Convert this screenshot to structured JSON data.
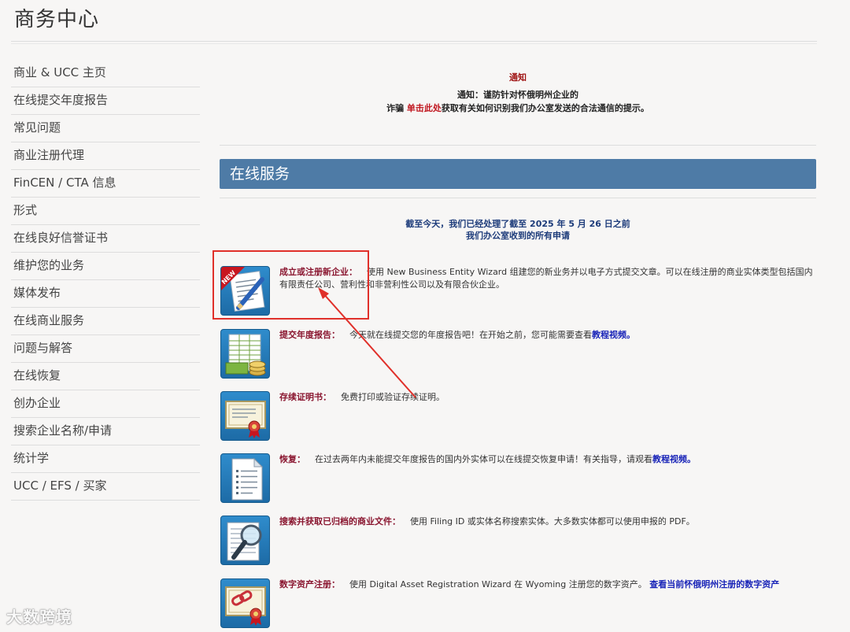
{
  "header": {
    "title": "商务中心"
  },
  "sidebar": {
    "items": [
      "商业 & UCC 主页",
      "在线提交年度报告",
      "常见问题",
      "商业注册代理",
      "FinCEN / CTA 信息",
      "形式",
      "在线良好信誉证书",
      "维护您的业务",
      "媒体发布",
      "在线商业服务",
      "问题与解答",
      "在线恢复",
      "创办企业",
      "搜索企业名称/申请",
      "统计学",
      "UCC / EFS / 买家"
    ]
  },
  "notice": {
    "heading": "通知",
    "line1": "通知：谨防针对怀俄明州企业的",
    "line2_pre": "诈骗 ",
    "line2_link": "单击此处",
    "line2_post": "获取有关如何识别我们办公室发送的合法通信的提示。"
  },
  "banner": {
    "title": "在线服务"
  },
  "status": {
    "line1": "截至今天，我们已经处理了截至 2025 年 5 月 26 日之前",
    "line2": "我们办公室收到的所有申请"
  },
  "services": [
    {
      "heading": "成立或注册新企业：",
      "text": "使用 New Business Entity Wizard 组建您的新业务并以电子方式提交文章。可以在线注册的商业实体类型包括国内有限责任公司、营利性和非营利性公司以及有限合伙企业。",
      "link": "",
      "icon": "new-document-pen-icon",
      "badge": "NEW"
    },
    {
      "heading": "提交年度报告：",
      "text": "今天就在线提交您的年度报告吧！在开始之前，您可能需要查看",
      "link": "教程视频。",
      "icon": "spreadsheet-money-icon"
    },
    {
      "heading": "存续证明书：",
      "text": "免费打印或验证存续证明。",
      "link": "",
      "icon": "certificate-icon"
    },
    {
      "heading": "恢复：",
      "text": "在过去两年内未能提交年度报告的国内外实体可以在线提交恢复申请！有关指导，请观看",
      "link": "教程视频。",
      "icon": "document-list-icon"
    },
    {
      "heading": "搜索并获取已归档的商业文件：",
      "text": "使用 Filing ID 或实体名称搜索实体。大多数实体都可以使用申报的 PDF。",
      "link": "",
      "icon": "magnifier-document-icon"
    },
    {
      "heading": "数字资产注册：",
      "text": "使用 Digital Asset Registration Wizard 在 Wyoming 注册您的数字资产。",
      "link": "查看当前怀俄明州注册的数字资产",
      "icon": "chain-link-certificate-icon"
    }
  ],
  "watermark": {
    "text": "大数跨境"
  },
  "colors": {
    "banner": "#4e7ba6",
    "heading": "#8a1630",
    "link": "#1a25b8",
    "annotation": "#e0302a"
  }
}
